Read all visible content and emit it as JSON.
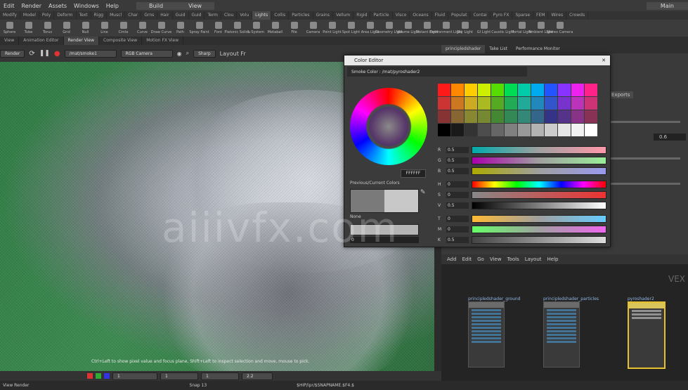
{
  "menubar": {
    "items": [
      "Edit",
      "Render",
      "Assets",
      "Windows",
      "Help"
    ],
    "desktop": "Build",
    "main_label": "Main",
    "view_label": "View"
  },
  "shelf_tabs": [
    "Modify",
    "Model",
    "Poly",
    "Deform",
    "Text",
    "Rigg",
    "Muscl",
    "Char",
    "Grns",
    "Hair",
    "Guid",
    "Guid",
    "Term",
    "Clou",
    "Volu",
    "Lights",
    "Collis",
    "Particles",
    "Grains",
    "Vellum",
    "Rigid",
    "Particle",
    "Visco",
    "Oceans",
    "Fluid",
    "Populat",
    "Contai",
    "Pyro FX",
    "Sparse",
    "FEM",
    "Wires",
    "Crowds"
  ],
  "tools": [
    "Sphere",
    "Tube",
    "Torus",
    "Grid",
    "Null",
    "Line",
    "Circle",
    "Curve",
    "Draw Curve",
    "Path",
    "Spray Paint",
    "Font",
    "Platonic Solids",
    "L-System",
    "Metaball",
    "File",
    "Camera",
    "Point Light",
    "Spot Light",
    "Area Light",
    "Geometry Light",
    "Volume Light",
    "Distant Light",
    "Environment Light",
    "Sky Light",
    "GI Light",
    "Caustic Light",
    "Portal Light",
    "Ambient Light",
    "Stereo Camera"
  ],
  "pane_tabs": [
    "View",
    "Animation Editor",
    "Render View",
    "Composite View",
    "Motion FX View"
  ],
  "viewbar": {
    "render_label": "Render",
    "node_path": "/mat/smoke1",
    "camera": "RGB Camera",
    "snap_label": "Sharp",
    "layout_label": "Layout Fr"
  },
  "render_hint": "Ctrl+Left to show pixel value and focus plane, Shift+Left to inspect selection and move, mouse to pick.",
  "bottombar": {
    "frame_val": "1",
    "field2": "1",
    "field3": "1",
    "zoom": "2.2"
  },
  "status": {
    "scene": "View Render",
    "snap": "Snap 13",
    "path_text": "$HIP/ipr/$SNAPNAME.$F4.$"
  },
  "right_tabs": [
    "principledshader",
    "Take List",
    "Performance Monitor"
  ],
  "right_panel": {
    "val": "0.6",
    "exports": "Exports"
  },
  "net_menu": [
    "Add",
    "Edit",
    "Go",
    "View",
    "Tools",
    "Layout",
    "Help"
  ],
  "net_badge": "VEX",
  "nodes": [
    {
      "label": "principledshader_ground"
    },
    {
      "label": "principledshader_particles"
    },
    {
      "label": "pyroshader2"
    }
  ],
  "color_editor": {
    "title": "Color Editor",
    "path": "Smoke Color : /mat/pyroshader2",
    "hex": "FFFFFF",
    "prev_label": "Previous/Current Colors",
    "none_label": "None",
    "zero": "0",
    "sliders": [
      {
        "label": "R",
        "value": "0.5"
      },
      {
        "label": "G",
        "value": "0.5"
      },
      {
        "label": "B",
        "value": "0.5"
      },
      {
        "label": "H",
        "value": "0"
      },
      {
        "label": "S",
        "value": "0"
      },
      {
        "label": "V",
        "value": "0.5"
      },
      {
        "label": "T",
        "value": "0"
      },
      {
        "label": "M",
        "value": "0"
      },
      {
        "label": "K",
        "value": "0.5"
      }
    ]
  },
  "watermark": "aiiivfx.com"
}
